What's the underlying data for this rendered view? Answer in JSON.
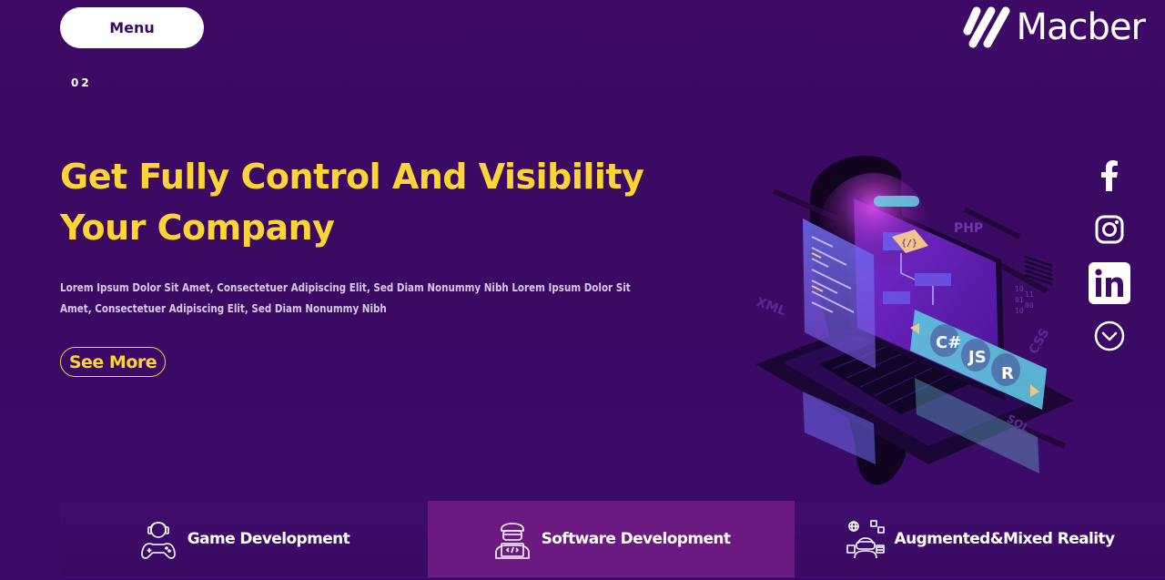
{
  "header": {
    "menu_label": "Menu",
    "slide_number": "02",
    "logo_text": "Macber"
  },
  "hero": {
    "title_line1": "Get Fully Control And Visibility",
    "title_line2": "Your Company",
    "description": "Lorem Ipsum Dolor Sit Amet, Consectetuer Adipiscing Elit, Sed Diam Nonummy Nibh Lorem Ipsum Dolor Sit Amet, Consectetuer Adipiscing Elit, Sed Diam Nonummy Nibh",
    "cta_label": "See More"
  },
  "social": {
    "items": [
      "facebook-icon",
      "instagram-icon",
      "linkedin-icon",
      "scroll-down-icon"
    ]
  },
  "illustration": {
    "labels": [
      "PHP",
      "XML",
      "CSS",
      "C#",
      "JS",
      "R",
      "SQL"
    ]
  },
  "services": {
    "items": [
      {
        "label": "Game Development",
        "icon": "gamer-icon"
      },
      {
        "label": "Software Development",
        "icon": "developer-icon"
      },
      {
        "label": "Augmented&Mixed Reality",
        "icon": "ar-vr-icon"
      }
    ]
  },
  "colors": {
    "background": "#3e0a66",
    "accent_yellow": "#fcd535",
    "active_service": "#6a1a80",
    "white": "#ffffff"
  }
}
